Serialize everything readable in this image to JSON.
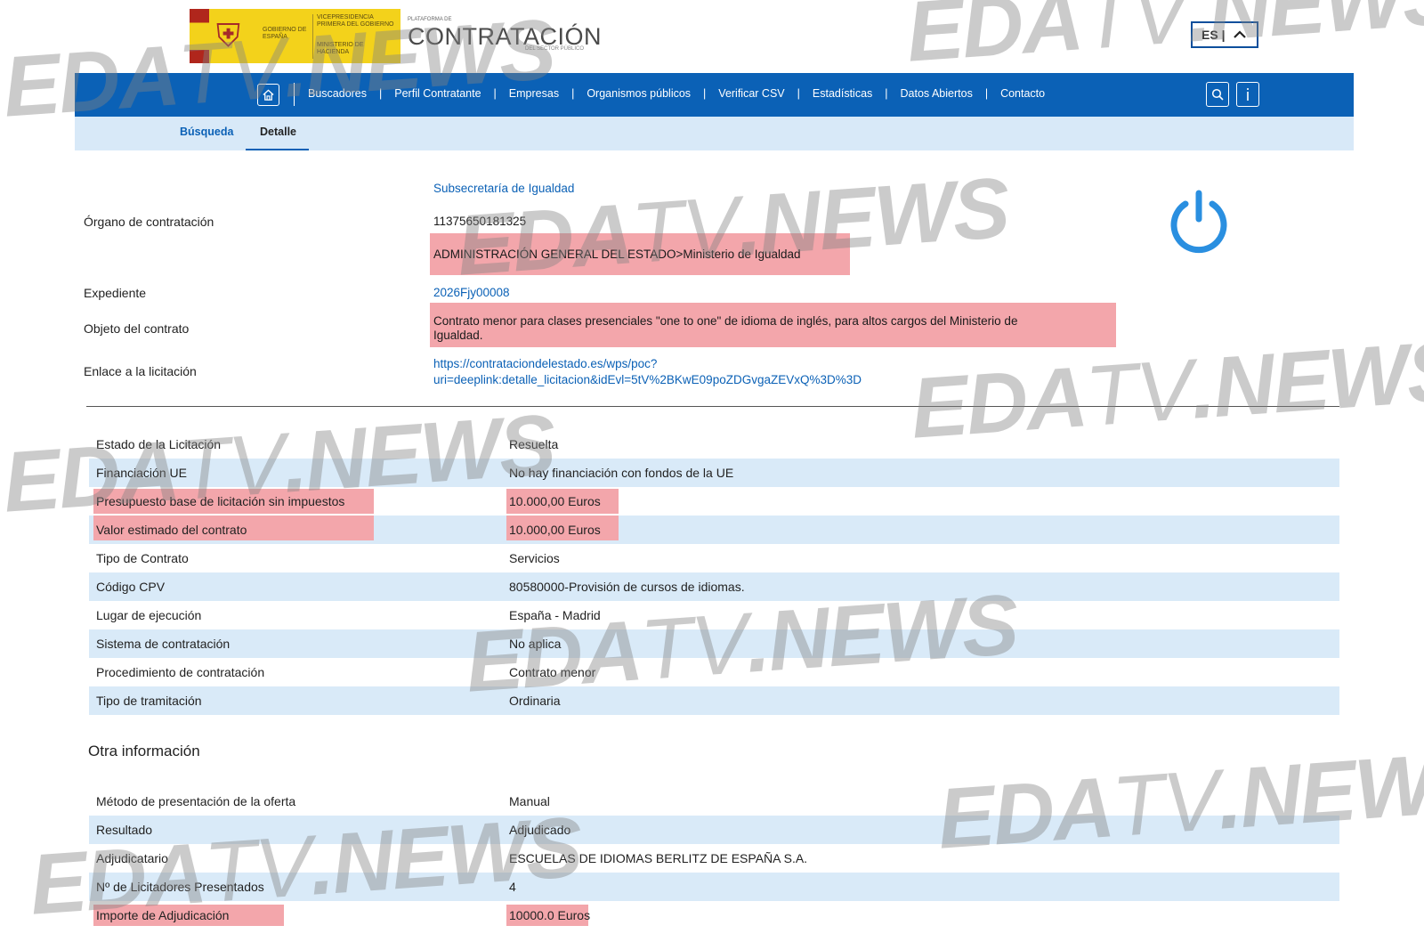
{
  "logo": {
    "gobierno": "GOBIERNO DE ESPAÑA",
    "vicepresidencia": "VICEPRESIDENCIA PRIMERA DEL GOBIERNO",
    "ministerio": "MINISTERIO DE HACIENDA",
    "plataforma_small": "PLATAFORMA DE",
    "plataforma_title": "CONTRATACIÓN",
    "plataforma_sub": "DEL SECTOR PÚBLICO"
  },
  "lang": {
    "label": "ES |",
    "icon": "chevron-up-icon"
  },
  "nav": {
    "home_icon": "home-icon",
    "links": [
      "Buscadores",
      "Perfil Contratante",
      "Empresas",
      "Organismos públicos",
      "Verificar CSV",
      "Estadísticas",
      "Datos Abiertos",
      "Contacto"
    ],
    "search_icon": "search-icon",
    "info_icon": "info-icon"
  },
  "subnav": {
    "busqueda": "Búsqueda",
    "detalle": "Detalle"
  },
  "header_info": {
    "organo_label": "Órgano de contratación",
    "organo_name": "Subsecretaría de Igualdad",
    "organo_id": "11375650181325",
    "organo_path": "ADMINISTRACIÓN GENERAL DEL ESTADO>Ministerio de Igualdad",
    "expediente_label": "Expediente",
    "expediente_value": "2026Fjy00008",
    "objeto_label": "Objeto del contrato",
    "objeto_line1": "Contrato menor para clases presenciales \"one to one\" de idioma de inglés, para altos cargos del Ministerio de",
    "objeto_line2": "Igualdad.",
    "enlace_label": "Enlace a la licitación",
    "enlace_line1": "https://contrataciondelestado.es/wps/poc?",
    "enlace_line2": "uri=deeplink:detalle_licitacion&idEvl=5tV%2BKwE09poZDGvgaZEVxQ%3D%3D"
  },
  "details": [
    {
      "label": "Estado de la Licitación",
      "value": "Resuelta"
    },
    {
      "label": "Financiación UE",
      "value": "No hay financiación con fondos de la UE"
    },
    {
      "label": "Presupuesto base de licitación sin impuestos",
      "value": "10.000,00 Euros"
    },
    {
      "label": "Valor estimado del contrato",
      "value": "10.000,00 Euros"
    },
    {
      "label": "Tipo de Contrato",
      "value": "Servicios"
    },
    {
      "label": "Código CPV",
      "value": "80580000-Provisión de cursos de idiomas."
    },
    {
      "label": "Lugar de ejecución",
      "value": "España - Madrid"
    },
    {
      "label": "Sistema de contratación",
      "value": "No aplica"
    },
    {
      "label": "Procedimiento de contratación",
      "value": "Contrato menor"
    },
    {
      "label": "Tipo de tramitación",
      "value": "Ordinaria"
    }
  ],
  "otra": {
    "title": "Otra información",
    "rows": [
      {
        "label": "Método de presentación de la oferta",
        "value": "Manual"
      },
      {
        "label": "Resultado",
        "value": "Adjudicado"
      },
      {
        "label": "Adjudicatario",
        "value": "ESCUELAS DE IDIOMAS BERLITZ DE ESPAÑA S.A."
      },
      {
        "label": "Nº de Licitadores Presentados",
        "value": "4"
      },
      {
        "label": "Importe de Adjudicación",
        "value": "10000.0 Euros"
      }
    ]
  },
  "watermark": {
    "part1": "EDA",
    "part2": "TV",
    "part3": ".NEWS"
  },
  "colors": {
    "nav_blue": "#0b61b6",
    "sub_bar": "#d8e9f8",
    "row_shade": "#d9eaf8",
    "highlight": "#f3a6ab",
    "power_blue": "#2a8fe0"
  }
}
